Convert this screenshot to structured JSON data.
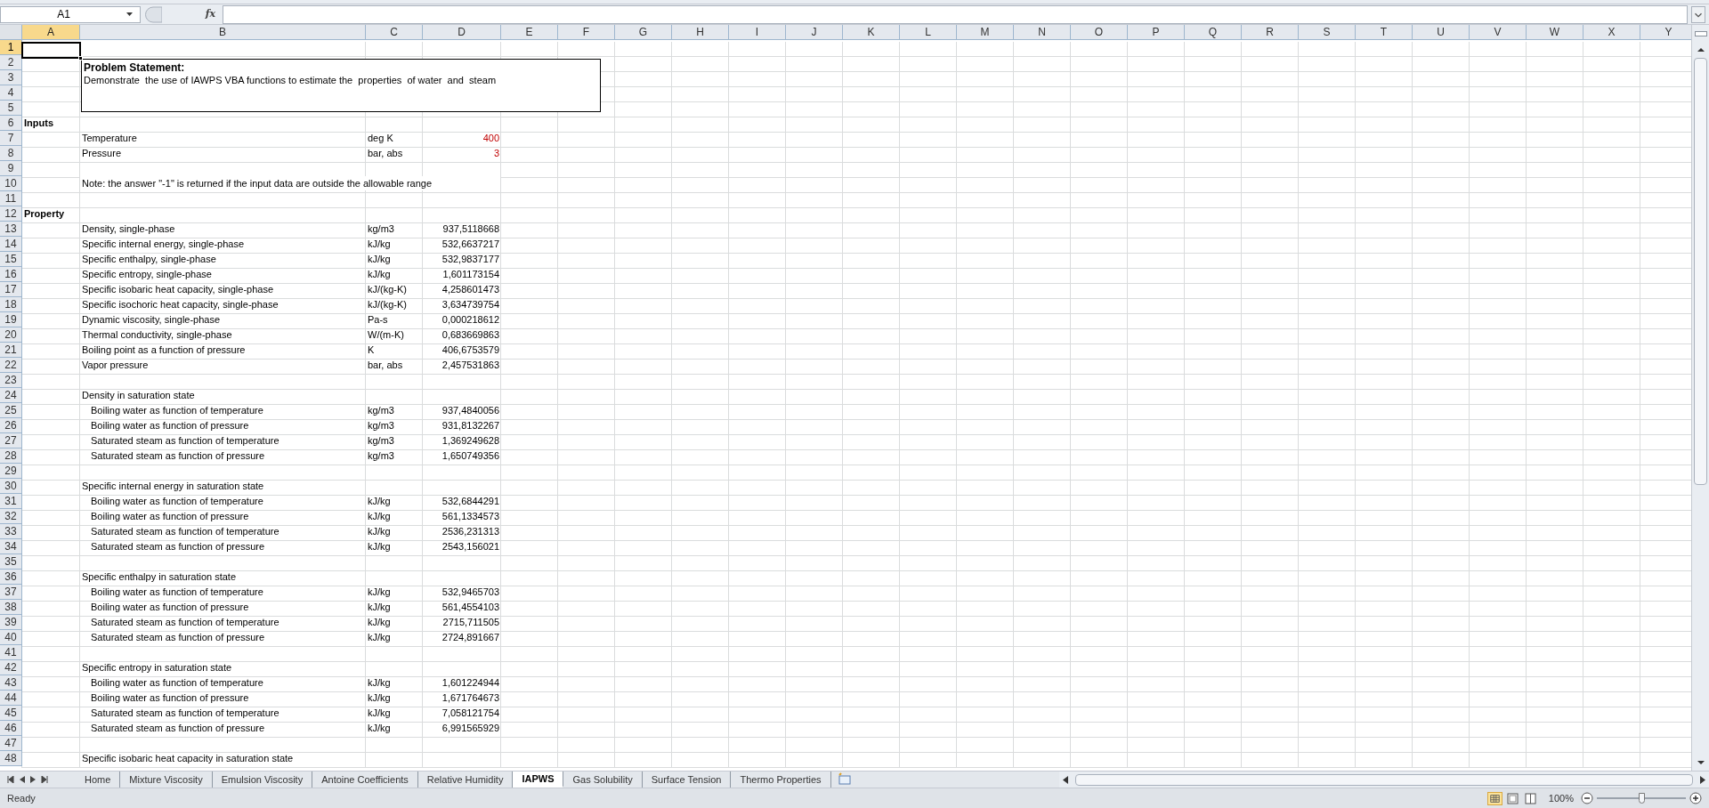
{
  "name_box": {
    "value": "A1"
  },
  "formula_bar": {
    "fx": "fx"
  },
  "columns": [
    {
      "label": "A",
      "selected": true
    },
    {
      "label": "B",
      "selected": false
    },
    {
      "label": "C",
      "selected": false
    },
    {
      "label": "D",
      "selected": false
    },
    {
      "label": "E",
      "selected": false
    },
    {
      "label": "F",
      "selected": false
    },
    {
      "label": "G",
      "selected": false
    },
    {
      "label": "H",
      "selected": false
    },
    {
      "label": "I",
      "selected": false
    },
    {
      "label": "J",
      "selected": false
    },
    {
      "label": "K",
      "selected": false
    },
    {
      "label": "L",
      "selected": false
    },
    {
      "label": "M",
      "selected": false
    },
    {
      "label": "N",
      "selected": false
    },
    {
      "label": "O",
      "selected": false
    },
    {
      "label": "P",
      "selected": false
    },
    {
      "label": "Q",
      "selected": false
    },
    {
      "label": "R",
      "selected": false
    },
    {
      "label": "S",
      "selected": false
    },
    {
      "label": "T",
      "selected": false
    },
    {
      "label": "U",
      "selected": false
    },
    {
      "label": "V",
      "selected": false
    },
    {
      "label": "W",
      "selected": false
    },
    {
      "label": "X",
      "selected": false
    },
    {
      "label": "Y",
      "selected": false
    }
  ],
  "text_box": {
    "title": "Problem Statement:",
    "text": "Demonstrate  the use of IAWPS VBA functions to estimate the  properties  of water  and  steam"
  },
  "rows": [
    {
      "number": "1",
      "selected": true,
      "kind": "blank"
    },
    {
      "number": "2",
      "selected": false,
      "kind": "blank"
    },
    {
      "number": "3",
      "selected": false,
      "kind": "blank"
    },
    {
      "number": "4",
      "selected": false,
      "kind": "blank"
    },
    {
      "number": "5",
      "selected": false,
      "kind": "blank"
    },
    {
      "number": "6",
      "selected": false,
      "kind": "heading",
      "a": "Inputs"
    },
    {
      "number": "7",
      "selected": false,
      "kind": "input",
      "label": "Temperature",
      "unit": "deg K",
      "value": "400"
    },
    {
      "number": "8",
      "selected": false,
      "kind": "input",
      "label": "Pressure",
      "unit": "bar, abs",
      "value": "3"
    },
    {
      "number": "9",
      "selected": false,
      "kind": "blank"
    },
    {
      "number": "10",
      "selected": false,
      "kind": "note",
      "label": "Note: the answer \"-1\" is returned if the input data are outside the allowable range"
    },
    {
      "number": "11",
      "selected": false,
      "kind": "blank"
    },
    {
      "number": "12",
      "selected": false,
      "kind": "heading",
      "a": "Property"
    },
    {
      "number": "13",
      "selected": false,
      "kind": "data",
      "label": "Density, single-phase",
      "unit": "kg/m3",
      "value": "937,5118668"
    },
    {
      "number": "14",
      "selected": false,
      "kind": "data",
      "label": "Specific internal energy, single-phase",
      "unit": "kJ/kg",
      "value": "532,6637217"
    },
    {
      "number": "15",
      "selected": false,
      "kind": "data",
      "label": "Specific enthalpy, single-phase",
      "unit": "kJ/kg",
      "value": "532,9837177"
    },
    {
      "number": "16",
      "selected": false,
      "kind": "data",
      "label": "Specific entropy, single-phase",
      "unit": "kJ/kg",
      "value": "1,601173154"
    },
    {
      "number": "17",
      "selected": false,
      "kind": "data",
      "label": "Specific isobaric heat capacity, single-phase",
      "unit": "kJ/(kg-K)",
      "value": "4,258601473"
    },
    {
      "number": "18",
      "selected": false,
      "kind": "data",
      "label": "Specific isochoric heat capacity, single-phase",
      "unit": "kJ/(kg-K)",
      "value": "3,634739754"
    },
    {
      "number": "19",
      "selected": false,
      "kind": "data",
      "label": "Dynamic viscosity, single-phase",
      "unit": "Pa-s",
      "value": "0,000218612"
    },
    {
      "number": "20",
      "selected": false,
      "kind": "data",
      "label": "Thermal conductivity, single-phase",
      "unit": "W/(m-K)",
      "value": "0,683669863"
    },
    {
      "number": "21",
      "selected": false,
      "kind": "data",
      "label": "Boiling point as a function of pressure",
      "unit": "K",
      "value": "406,6753579"
    },
    {
      "number": "22",
      "selected": false,
      "kind": "data",
      "label": "Vapor pressure",
      "unit": "bar, abs",
      "value": "2,457531863"
    },
    {
      "number": "23",
      "selected": false,
      "kind": "blank"
    },
    {
      "number": "24",
      "selected": false,
      "kind": "group",
      "label": "Density in saturation state"
    },
    {
      "number": "25",
      "selected": false,
      "kind": "sub",
      "label": "Boiling water as function of temperature",
      "unit": "kg/m3",
      "value": "937,4840056"
    },
    {
      "number": "26",
      "selected": false,
      "kind": "sub",
      "label": "Boiling water as function of pressure",
      "unit": "kg/m3",
      "value": "931,8132267"
    },
    {
      "number": "27",
      "selected": false,
      "kind": "sub",
      "label": "Saturated steam as function of temperature",
      "unit": "kg/m3",
      "value": "1,369249628"
    },
    {
      "number": "28",
      "selected": false,
      "kind": "sub",
      "label": "Saturated steam as function of pressure",
      "unit": "kg/m3",
      "value": "1,650749356"
    },
    {
      "number": "29",
      "selected": false,
      "kind": "blank"
    },
    {
      "number": "30",
      "selected": false,
      "kind": "group",
      "label": "Specific internal energy in saturation state"
    },
    {
      "number": "31",
      "selected": false,
      "kind": "sub",
      "label": "Boiling water as function of temperature",
      "unit": "kJ/kg",
      "value": "532,6844291"
    },
    {
      "number": "32",
      "selected": false,
      "kind": "sub",
      "label": "Boiling water as function of pressure",
      "unit": "kJ/kg",
      "value": "561,1334573"
    },
    {
      "number": "33",
      "selected": false,
      "kind": "sub",
      "label": "Saturated steam as function of temperature",
      "unit": "kJ/kg",
      "value": "2536,231313"
    },
    {
      "number": "34",
      "selected": false,
      "kind": "sub",
      "label": "Saturated steam as function of pressure",
      "unit": "kJ/kg",
      "value": "2543,156021"
    },
    {
      "number": "35",
      "selected": false,
      "kind": "blank"
    },
    {
      "number": "36",
      "selected": false,
      "kind": "group",
      "label": "Specific enthalpy in saturation state"
    },
    {
      "number": "37",
      "selected": false,
      "kind": "sub",
      "label": "Boiling water as function of temperature",
      "unit": "kJ/kg",
      "value": "532,9465703"
    },
    {
      "number": "38",
      "selected": false,
      "kind": "sub",
      "label": "Boiling water as function of pressure",
      "unit": "kJ/kg",
      "value": "561,4554103"
    },
    {
      "number": "39",
      "selected": false,
      "kind": "sub",
      "label": "Saturated steam as function of temperature",
      "unit": "kJ/kg",
      "value": "2715,711505"
    },
    {
      "number": "40",
      "selected": false,
      "kind": "sub",
      "label": "Saturated steam as function of pressure",
      "unit": "kJ/kg",
      "value": "2724,891667"
    },
    {
      "number": "41",
      "selected": false,
      "kind": "blank"
    },
    {
      "number": "42",
      "selected": false,
      "kind": "group",
      "label": "Specific entropy in saturation state"
    },
    {
      "number": "43",
      "selected": false,
      "kind": "sub",
      "label": "Boiling water as function of temperature",
      "unit": "kJ/kg",
      "value": "1,601224944"
    },
    {
      "number": "44",
      "selected": false,
      "kind": "sub",
      "label": "Boiling water as function of pressure",
      "unit": "kJ/kg",
      "value": "1,671764673"
    },
    {
      "number": "45",
      "selected": false,
      "kind": "sub",
      "label": "Saturated steam as function of temperature",
      "unit": "kJ/kg",
      "value": "7,058121754"
    },
    {
      "number": "46",
      "selected": false,
      "kind": "sub",
      "label": "Saturated steam as function of pressure",
      "unit": "kJ/kg",
      "value": "6,991565929"
    },
    {
      "number": "47",
      "selected": false,
      "kind": "blank"
    },
    {
      "number": "48",
      "selected": false,
      "kind": "group",
      "label": "Specific isobaric heat capacity in saturation state"
    }
  ],
  "sheet_tabs": [
    {
      "label": "Home",
      "selected": false
    },
    {
      "label": "Mixture Viscosity",
      "selected": false
    },
    {
      "label": "Emulsion Viscosity",
      "selected": false
    },
    {
      "label": "Antoine Coefficients",
      "selected": false
    },
    {
      "label": "Relative Humidity",
      "selected": false
    },
    {
      "label": "IAPWS",
      "selected": true
    },
    {
      "label": "Gas Solubility",
      "selected": false
    },
    {
      "label": "Surface Tension",
      "selected": false
    },
    {
      "label": "Thermo Properties",
      "selected": false
    }
  ],
  "status_bar": {
    "status": "Ready",
    "zoom": "100%",
    "zoom_level": {
      "level": 0.5
    }
  }
}
